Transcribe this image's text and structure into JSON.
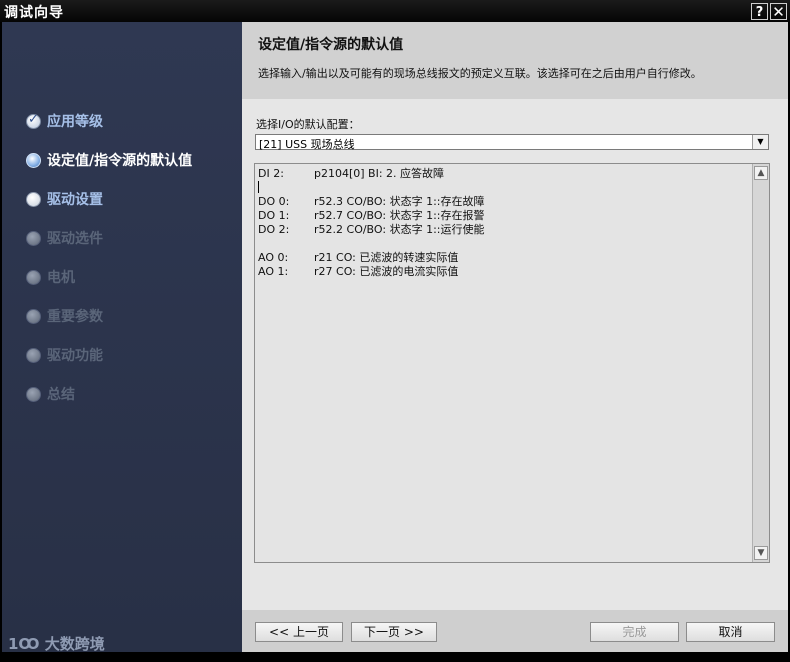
{
  "window": {
    "title": "调试向导",
    "help_label": "?",
    "close_label": "✕"
  },
  "sidebar": {
    "items": [
      {
        "label": "应用等级",
        "state": "done"
      },
      {
        "label": "设定值/指令源的默认值",
        "state": "current"
      },
      {
        "label": "驱动设置",
        "state": "enabled"
      },
      {
        "label": "驱动选件",
        "state": "disabled"
      },
      {
        "label": "电机",
        "state": "disabled"
      },
      {
        "label": "重要参数",
        "state": "disabled"
      },
      {
        "label": "驱动功能",
        "state": "disabled"
      },
      {
        "label": "总结",
        "state": "disabled"
      }
    ],
    "watermark": "1Ꝏ 大数跨境"
  },
  "header": {
    "title": "设定值/指令源的默认值",
    "description": "选择输入/输出以及可能有的现场总线报文的预定义互联。该选择可在之后由用户自行修改。"
  },
  "io_config": {
    "label": "选择I/O的默认配置：",
    "selected": "[21] USS 现场总线"
  },
  "io_lines": [
    {
      "key": "DI 2:",
      "value": "p2104[0] BI: 2. 应答故障"
    },
    {
      "key": "DO 0:",
      "value": "r52.3 CO/BO: 状态字 1::存在故障"
    },
    {
      "key": "DO 1:",
      "value": "r52.7 CO/BO: 状态字 1::存在报警"
    },
    {
      "key": "DO 2:",
      "value": "r52.2 CO/BO: 状态字 1::运行使能"
    },
    {
      "key": "AO 0:",
      "value": "r21 CO: 已滤波的转速实际值"
    },
    {
      "key": "AO 1:",
      "value": "r27 CO: 已滤波的电流实际值"
    }
  ],
  "footer": {
    "prev_label": "<< 上一页",
    "next_label": "下一页 >>",
    "finish_label": "完成",
    "cancel_label": "取消"
  }
}
